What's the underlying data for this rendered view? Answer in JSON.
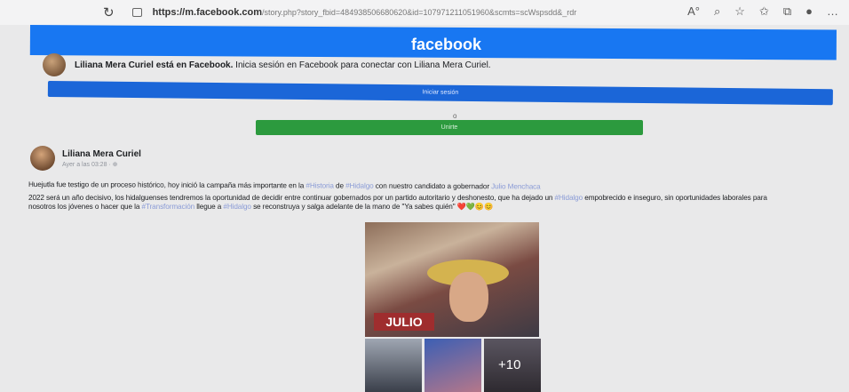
{
  "browser": {
    "url_domain": "https://m.facebook.com",
    "url_path": "/story.php?story_fbid=484938506680620&id=107971211051960&scmts=scWspsdd&_rdr"
  },
  "header": {
    "logo": "facebook"
  },
  "login_prompt": {
    "name_bold": "Liliana Mera Curiel está en Facebook.",
    "text": " Inicia sesión en Facebook para conectar con Liliana Mera Curiel.",
    "login_button": "Iniciar sesión",
    "separator": "o",
    "signup_button": "Unirte"
  },
  "post": {
    "author": "Liliana Mera Curiel",
    "timestamp": "Ayer a las 03:28 · ⊕",
    "line1_a": "Huejutla fue testigo de un proceso histórico, hoy inició la campaña más importante en la ",
    "line1_tag1": "#Historia",
    "line1_b": " de ",
    "line1_tag2": "#Hidalgo",
    "line1_c": " con nuestro candidato a gobernador ",
    "line1_link": "Julio Menchaca",
    "line2_a": "2022 será un año decisivo, los hidalguenses tendremos la oportunidad de decidir entre continuar gobernados por un partido autoritario y deshonesto, que ha dejado un ",
    "line2_tag": "#Hidalgo",
    "line2_b": " empobrecido e inseguro, sin oportunidades laborales para",
    "line3_a": "nosotros los jóvenes o hacer que la ",
    "line3_tag1": "#Transformación",
    "line3_b": " llegue a ",
    "line3_tag2": "#Hidalgo",
    "line3_c": " se reconstruya y salga adelante de la mano de \"Ya sabes quién\" ❤️💚😊😊",
    "photo_sign": "JULIO",
    "more_photos": "+10"
  }
}
